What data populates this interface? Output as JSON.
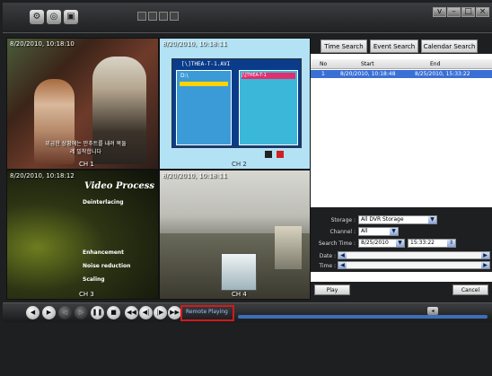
{
  "cameras": [
    {
      "timestamp": "8/20/2010, 10:18:10",
      "label": "CH 1",
      "subtitle": "위급한 상황에는 만추트를 내려 목둘레 밀착합니다"
    },
    {
      "timestamp": "8/20/2010, 10:18:11",
      "label": "CH 2",
      "file_title": "[\\]THEA-T-1.AVI",
      "dir_left": "D:\\",
      "dir_right": "[\\]THEA-T-1"
    },
    {
      "timestamp": "8/20/2010, 10:18:12",
      "label": "CH 3",
      "title": "Video Process",
      "menu": [
        "Deinterlacing",
        "Enhancement",
        "Noise reduction",
        "Scaling"
      ]
    },
    {
      "timestamp": "8/20/2010, 10:18:11",
      "label": "CH 4"
    }
  ],
  "tabs": [
    "Time Search",
    "Event Search",
    "Calendar Search"
  ],
  "results": {
    "columns": [
      "No",
      "Start",
      "End"
    ],
    "rows": [
      {
        "no": "1",
        "start": "8/20/2010, 10:18:48",
        "end": "8/25/2010, 15:33:22"
      }
    ]
  },
  "search": {
    "storage_label": "Storage :",
    "storage_value": "All DVR Storage",
    "channel_label": "Channel :",
    "channel_value": "All",
    "time_label": "Search Time :",
    "date_value": "8/25/2010",
    "time_value": "15:33:22",
    "date_label": "Date :",
    "time_slider_label": "Time :"
  },
  "buttons": {
    "play": "Play",
    "cancel": "Cancel"
  },
  "status_text": "Remote Playing",
  "progress": 0.78,
  "window_controls": [
    "v",
    "–",
    "□",
    "×"
  ]
}
